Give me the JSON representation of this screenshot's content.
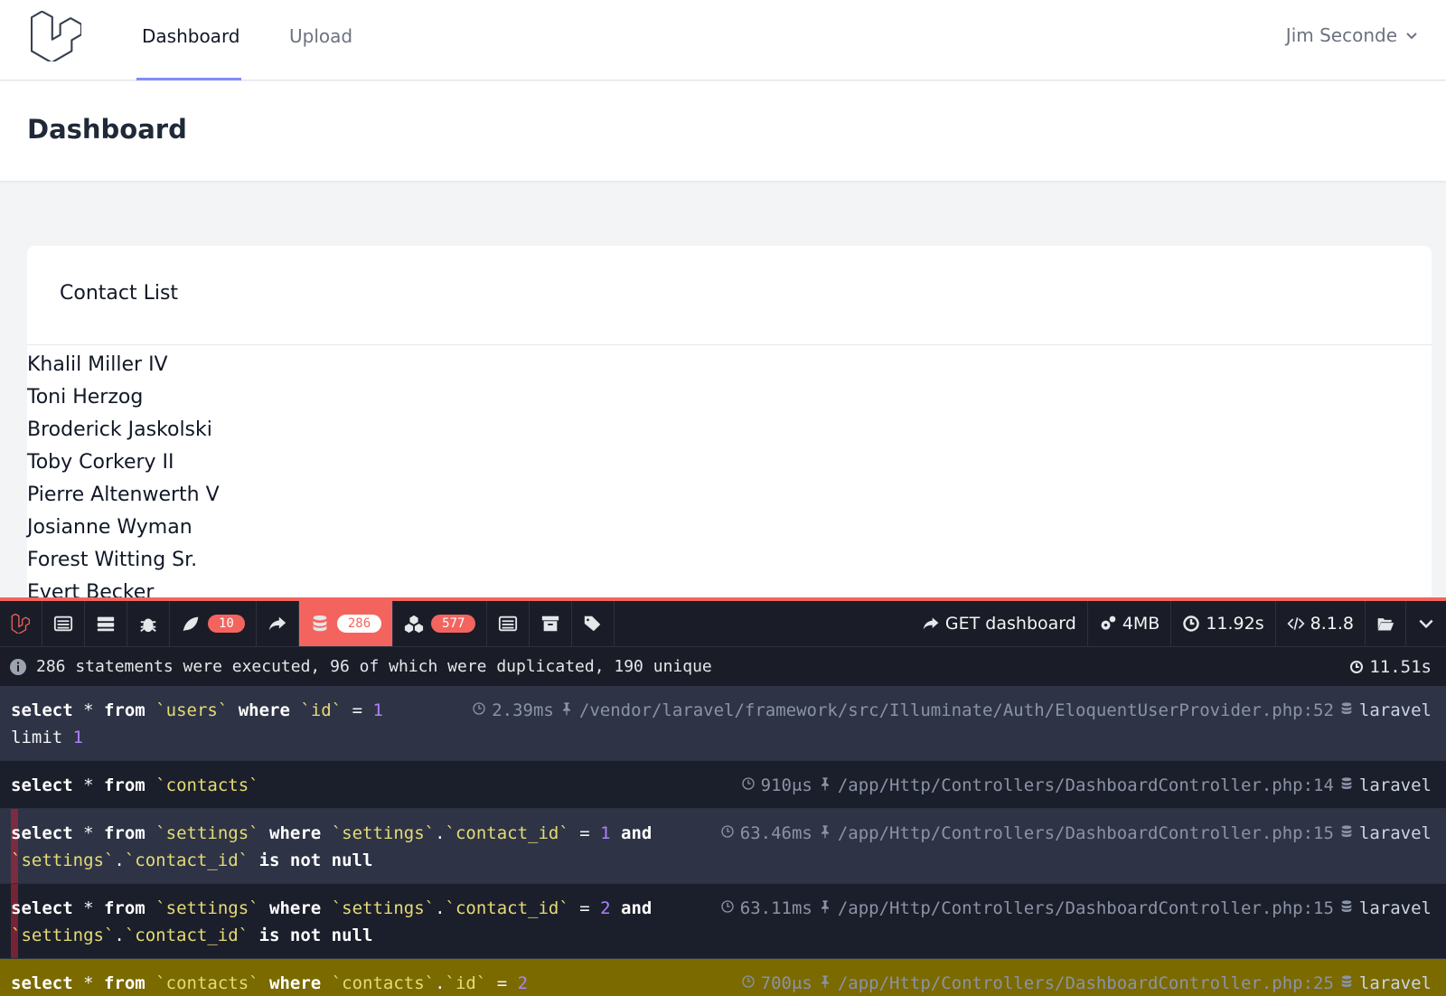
{
  "nav": {
    "links": [
      {
        "label": "Dashboard",
        "active": true
      },
      {
        "label": "Upload",
        "active": false
      }
    ],
    "user_name": "Jim Seconde"
  },
  "header": {
    "title": "Dashboard"
  },
  "card": {
    "title": "Contact List",
    "contacts": [
      "Khalil Miller IV",
      "Toni Herzog",
      "Broderick Jaskolski",
      "Toby Corkery II",
      "Pierre Altenwerth V",
      "Josianne Wyman",
      "Forest Witting Sr.",
      "Evert Becker"
    ]
  },
  "debugbar": {
    "accent": "#f4645f",
    "tabs": [
      {
        "name": "messages",
        "icon": "list-icon"
      },
      {
        "name": "timeline",
        "icon": "tasks-icon"
      },
      {
        "name": "exceptions",
        "icon": "bug-icon"
      },
      {
        "name": "views",
        "icon": "leaf-icon",
        "badge": "10"
      },
      {
        "name": "route",
        "icon": "share-icon"
      },
      {
        "name": "queries",
        "icon": "database-icon",
        "badge": "286",
        "active": true
      },
      {
        "name": "models",
        "icon": "cubes-icon",
        "badge": "577"
      },
      {
        "name": "mails",
        "icon": "inbox-icon"
      },
      {
        "name": "session",
        "icon": "archive-icon"
      },
      {
        "name": "request",
        "icon": "tags-icon"
      }
    ],
    "request": "GET dashboard",
    "memory": "4MB",
    "duration": "11.92s",
    "php_version": "8.1.8",
    "summary": "286 statements were executed, 96 of which were duplicated, 190 unique",
    "total_time": "11.51s",
    "statements": [
      {
        "tokens": [
          [
            "kw",
            "select"
          ],
          [
            "t",
            " * "
          ],
          [
            "kw",
            "from"
          ],
          [
            "t",
            " "
          ],
          [
            "id",
            "`users`"
          ],
          [
            "t",
            " "
          ],
          [
            "kw",
            "where"
          ],
          [
            "t",
            " "
          ],
          [
            "id",
            "`id`"
          ],
          [
            "t",
            " = "
          ],
          [
            "num",
            "1"
          ],
          [
            "t",
            "\n"
          ],
          [
            "t",
            "limit "
          ],
          [
            "num",
            "1"
          ]
        ],
        "time": "2.39ms",
        "source": "/vendor/laravel/framework/src/Illuminate/Auth/EloquentUserProvider.php:52",
        "connection": "laravel",
        "style": "odd"
      },
      {
        "tokens": [
          [
            "kw",
            "select"
          ],
          [
            "t",
            " * "
          ],
          [
            "kw",
            "from"
          ],
          [
            "t",
            " "
          ],
          [
            "id",
            "`contacts`"
          ]
        ],
        "time": "910μs",
        "source": "/app/Http/Controllers/DashboardController.php:14",
        "connection": "laravel",
        "style": "even"
      },
      {
        "tokens": [
          [
            "kw",
            "select"
          ],
          [
            "t",
            " * "
          ],
          [
            "kw",
            "from"
          ],
          [
            "t",
            " "
          ],
          [
            "id",
            "`settings`"
          ],
          [
            "t",
            " "
          ],
          [
            "kw",
            "where"
          ],
          [
            "t",
            " "
          ],
          [
            "id",
            "`settings`"
          ],
          [
            "t",
            "."
          ],
          [
            "id",
            "`contact_id`"
          ],
          [
            "t",
            " = "
          ],
          [
            "num",
            "1"
          ],
          [
            "t",
            " "
          ],
          [
            "kw",
            "and"
          ],
          [
            "t",
            "\n"
          ],
          [
            "id",
            "`settings`"
          ],
          [
            "t",
            "."
          ],
          [
            "id",
            "`contact_id`"
          ],
          [
            "t",
            " "
          ],
          [
            "kw",
            "is not null"
          ]
        ],
        "time": "63.46ms",
        "source": "/app/Http/Controllers/DashboardController.php:15",
        "connection": "laravel",
        "style": "odd dup"
      },
      {
        "tokens": [
          [
            "kw",
            "select"
          ],
          [
            "t",
            " * "
          ],
          [
            "kw",
            "from"
          ],
          [
            "t",
            " "
          ],
          [
            "id",
            "`settings`"
          ],
          [
            "t",
            " "
          ],
          [
            "kw",
            "where"
          ],
          [
            "t",
            " "
          ],
          [
            "id",
            "`settings`"
          ],
          [
            "t",
            "."
          ],
          [
            "id",
            "`contact_id`"
          ],
          [
            "t",
            " = "
          ],
          [
            "num",
            "2"
          ],
          [
            "t",
            " "
          ],
          [
            "kw",
            "and"
          ],
          [
            "t",
            "\n"
          ],
          [
            "id",
            "`settings`"
          ],
          [
            "t",
            "."
          ],
          [
            "id",
            "`contact_id`"
          ],
          [
            "t",
            " "
          ],
          [
            "kw",
            "is not null"
          ]
        ],
        "time": "63.11ms",
        "source": "/app/Http/Controllers/DashboardController.php:15",
        "connection": "laravel",
        "style": "even dup"
      },
      {
        "tokens": [
          [
            "kw",
            "select"
          ],
          [
            "t",
            " * "
          ],
          [
            "kw",
            "from"
          ],
          [
            "t",
            " "
          ],
          [
            "id",
            "`contacts`"
          ],
          [
            "t",
            " "
          ],
          [
            "kw",
            "where"
          ],
          [
            "t",
            " "
          ],
          [
            "id",
            "`contacts`"
          ],
          [
            "t",
            "."
          ],
          [
            "id",
            "`id`"
          ],
          [
            "t",
            " = "
          ],
          [
            "num",
            "2"
          ]
        ],
        "time": "700μs",
        "source": "/app/Http/Controllers/DashboardController.php:25",
        "connection": "laravel",
        "style": "hl"
      }
    ]
  }
}
